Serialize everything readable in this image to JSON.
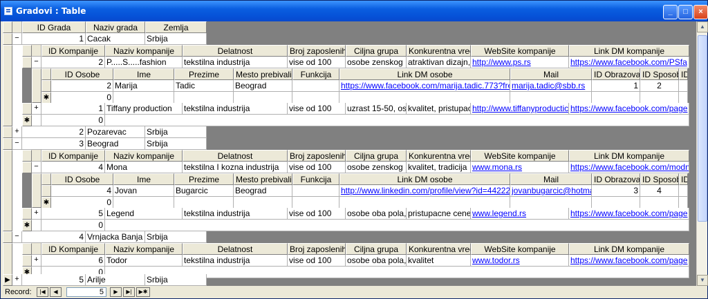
{
  "window": {
    "title": "Gradovi : Table"
  },
  "titlebar_buttons": {
    "minimize": "_",
    "maximize": "□",
    "close": "×"
  },
  "headers": {
    "city": [
      "ID Grada",
      "Naziv grada",
      "Zemlja"
    ],
    "company": [
      "ID Kompanije",
      "Naziv kompanije",
      "Delatnost",
      "Broj zaposlenih",
      "Ciljna grupa",
      "Konkurentna vred",
      "WebSite kompanije",
      "Link DM kompanije"
    ],
    "person": [
      "ID Osobe",
      "Ime",
      "Prezime",
      "Mesto prebivalist",
      "Funkcija",
      "Link DM osobe",
      "Mail",
      "ID Obrazova",
      "ID Sposob",
      "ID"
    ]
  },
  "cities": [
    {
      "id": "1",
      "name": "Cacak",
      "country": "Srbija"
    },
    {
      "id": "2",
      "name": "Pozarevac",
      "country": "Srbija"
    },
    {
      "id": "3",
      "name": "Beograd",
      "country": "Srbija"
    },
    {
      "id": "4",
      "name": "Vrnjacka Banja",
      "country": "Srbija"
    },
    {
      "id": "5",
      "name": "Arilje",
      "country": "Srbija"
    }
  ],
  "companies": [
    {
      "id": "2",
      "name": "P.....S.....fashion",
      "activity": "tekstilna industrija",
      "employees": "vise od 100",
      "target": "osobe zenskog",
      "value": "atraktivan dizajn,",
      "web": "http://www.ps.rs",
      "dm": "https://www.facebook.com/PSfa"
    },
    {
      "id": "1",
      "name": "Tiffany production",
      "activity": "tekstilna industrija",
      "employees": "vise od 100",
      "target": "uzrast 15-50, os",
      "value": "kvalitet, pristupac",
      "web": "http://www.tiffanyproductic",
      "dm": "https://www.facebook.com/page"
    },
    {
      "id": "4",
      "name": "Mona",
      "activity": "tekstilna I kozna industrija",
      "employees": "vise od 100",
      "target": "osobe zenskog",
      "value": "kvalitet, tradicija",
      "web": "www.mona.rs",
      "dm": "https://www.facebook.com/modn"
    },
    {
      "id": "5",
      "name": "Legend",
      "activity": "tekstilna  industrija",
      "employees": "vise od 100",
      "target": "osobe oba pola,",
      "value": "pristupacne cene",
      "web": "www.legend.rs",
      "dm": "https://www.facebook.com/page"
    },
    {
      "id": "6",
      "name": "Todor",
      "activity": "tekstilna  industrija",
      "employees": "vise od 100",
      "target": "osobe oba pola,",
      "value": "kvalitet",
      "web": "www.todor.rs",
      "dm": "https://www.facebook.com/page"
    }
  ],
  "persons": [
    {
      "id": "2",
      "first": "Marija",
      "last": "Tadic",
      "place": "Beograd",
      "role": "",
      "dm": "https://www.facebook.com/marija.tadic.773?fre",
      "mail": "marija.tadic@sbb.rs",
      "edu": "1",
      "skill": "2"
    },
    {
      "id": "4",
      "first": "Jovan",
      "last": "Bugarcic",
      "place": "Beograd",
      "role": "",
      "dm": "http://www.linkedin.com/profile/view?id=442229",
      "mail": "jovanbugarcic@hotma",
      "edu": "3",
      "skill": "4"
    }
  ],
  "new_record_value": "0",
  "navigation": {
    "label": "Record:",
    "current": "5"
  },
  "symbols": {
    "expanded": "−",
    "collapsed": "+",
    "new_row": "✱",
    "current": "▶"
  }
}
